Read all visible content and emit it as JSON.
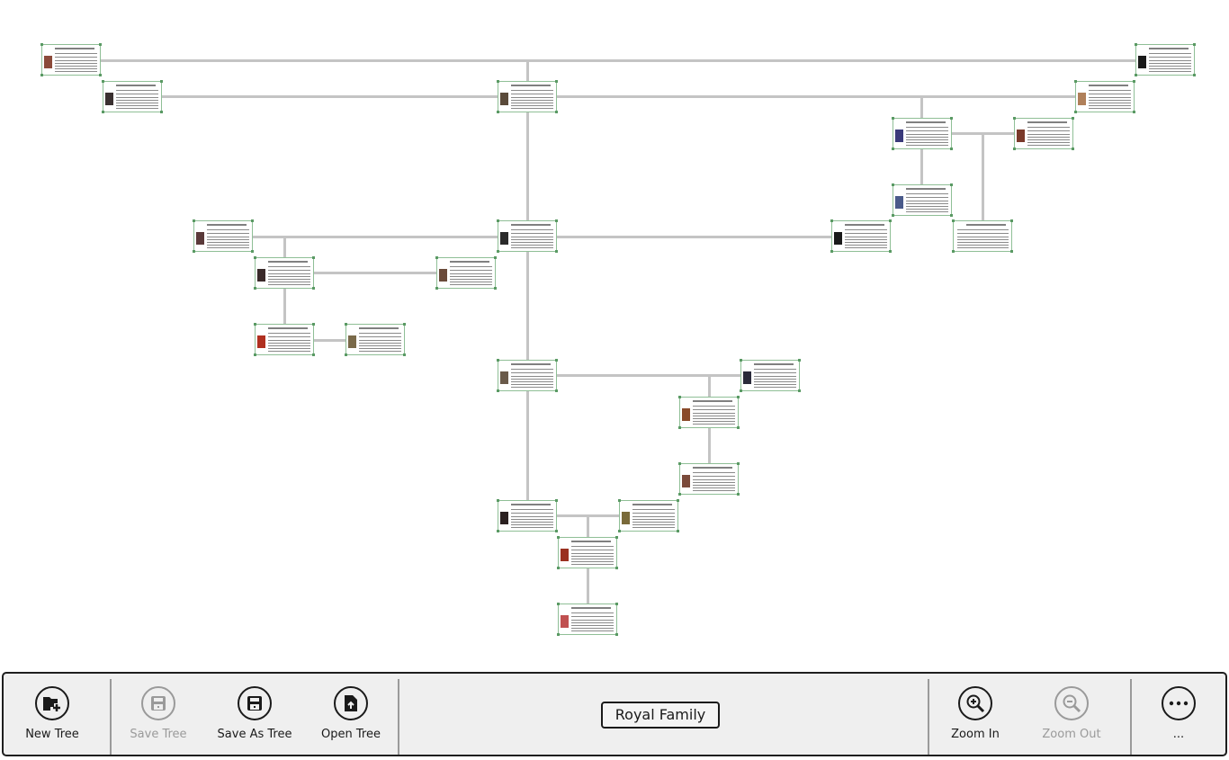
{
  "tree": {
    "name": "Royal Family",
    "nodes": [
      {
        "id": "n1",
        "photo_color": "#8b4a3a"
      },
      {
        "id": "n2",
        "photo_color": "#3a3030"
      },
      {
        "id": "n3",
        "photo_color": "#5a4a3a"
      },
      {
        "id": "n4",
        "photo_color": "#1a1a1a"
      },
      {
        "id": "n5",
        "photo_color": "#b0805a"
      },
      {
        "id": "n6",
        "photo_color": "#3a3a7a"
      },
      {
        "id": "n7",
        "photo_color": "#7a3a2a"
      },
      {
        "id": "n8",
        "photo_color": "#4a5a8a"
      },
      {
        "id": "n9",
        "photo_color": "#2a2a2a"
      },
      {
        "id": "n10",
        "photo_color": "#5a3a3a"
      },
      {
        "id": "n11",
        "photo_color": "#1a1a1a"
      },
      {
        "id": "n12",
        "photo_color": null
      },
      {
        "id": "n13",
        "photo_color": "#3a2a2a"
      },
      {
        "id": "n14",
        "photo_color": "#6a4a3a"
      },
      {
        "id": "n15",
        "photo_color": "#b03020"
      },
      {
        "id": "n16",
        "photo_color": "#7a6a4a"
      },
      {
        "id": "n17",
        "photo_color": "#6a5a4a"
      },
      {
        "id": "n18",
        "photo_color": "#2a2a3a"
      },
      {
        "id": "n19",
        "photo_color": "#8a4a2a"
      },
      {
        "id": "n20",
        "photo_color": "#7a4a3a"
      },
      {
        "id": "n21",
        "photo_color": "#2a2020"
      },
      {
        "id": "n22",
        "photo_color": "#7a6a3a"
      },
      {
        "id": "n23",
        "photo_color": "#9a3020"
      },
      {
        "id": "n24",
        "photo_color": "#c05050"
      },
      {
        "id": "n25",
        "photo_color": "#3a4a8a"
      }
    ]
  },
  "toolbar": {
    "new_tree": "New Tree",
    "save_tree": "Save Tree",
    "save_as_tree": "Save As Tree",
    "open_tree": "Open Tree",
    "zoom_in": "Zoom In",
    "zoom_out": "Zoom Out",
    "more": "...",
    "disabled": [
      "save_tree",
      "zoom_out"
    ]
  }
}
